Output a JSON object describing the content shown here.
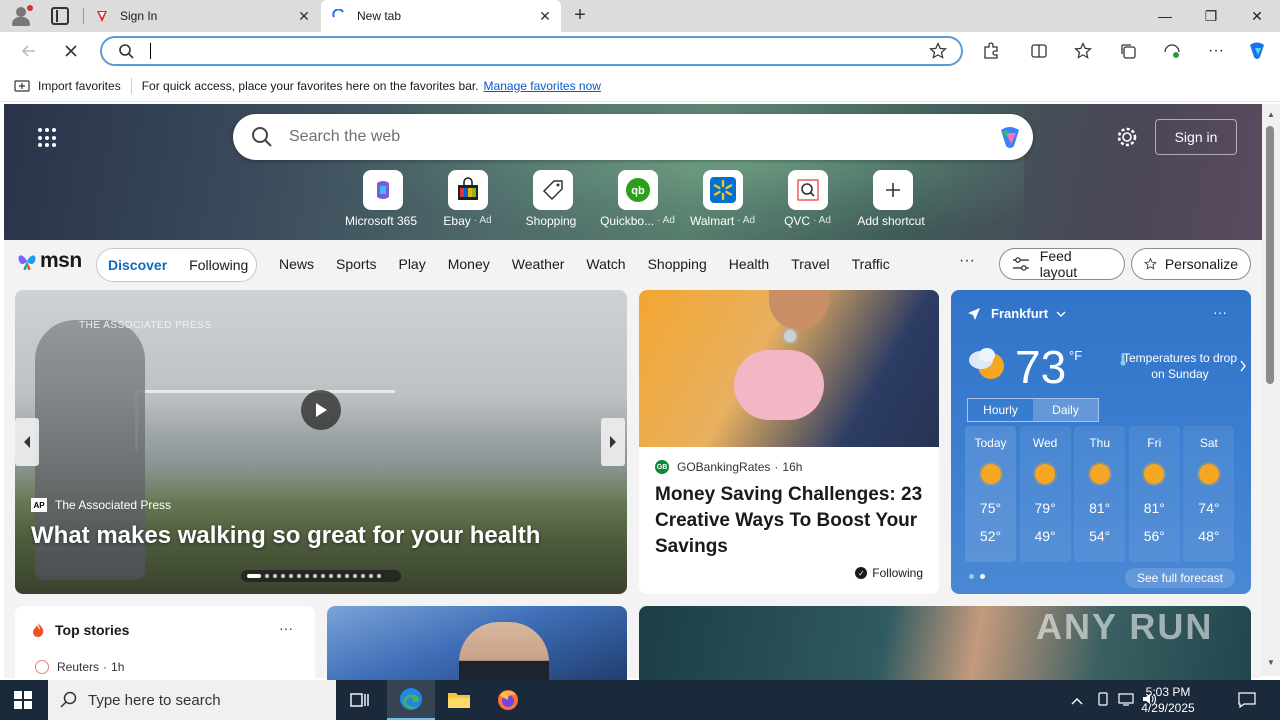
{
  "tabs": [
    {
      "title": "Sign In",
      "active": false
    },
    {
      "title": "New tab",
      "active": true
    }
  ],
  "addressbar": {
    "value": "",
    "placeholder": ""
  },
  "favorites_bar": {
    "import_label": "Import favorites",
    "message": "For quick access, place your favorites here on the favorites bar.",
    "link": "Manage favorites now"
  },
  "hero": {
    "search_placeholder": "Search the web",
    "sign_in": "Sign in",
    "shortcuts": [
      {
        "label": "Microsoft 365",
        "ad": "",
        "icon": "microsoft365-icon"
      },
      {
        "label": "Ebay",
        "ad": "· Ad",
        "icon": "ebay-icon"
      },
      {
        "label": "Shopping",
        "ad": "",
        "icon": "shopping-tag-icon"
      },
      {
        "label": "Quickbo...",
        "ad": "· Ad",
        "icon": "quickbooks-icon"
      },
      {
        "label": "Walmart",
        "ad": "· Ad",
        "icon": "walmart-icon"
      },
      {
        "label": "QVC",
        "ad": "· Ad",
        "icon": "qvc-icon"
      },
      {
        "label": "Add shortcut",
        "ad": "",
        "icon": "plus-icon"
      }
    ]
  },
  "msn": {
    "logo": "msn",
    "pills": [
      "Discover",
      "Following"
    ],
    "nav": [
      "News",
      "Sports",
      "Play",
      "Money",
      "Weather",
      "Watch",
      "Shopping",
      "Health",
      "Travel",
      "Traffic"
    ],
    "more": "···",
    "feed_layout": "Feed layout",
    "personalize": "Personalize"
  },
  "hero_story": {
    "watermark": "THE ASSOCIATED PRESS",
    "source": "The Associated Press",
    "source_logo": "AP",
    "title": "What makes walking so great for your health"
  },
  "money_story": {
    "source": "GOBankingRates",
    "time": "16h",
    "title": "Money Saving Challenges: 23 Creative Ways To Boost Your Savings",
    "following": "Following"
  },
  "weather": {
    "location": "Frankfurt",
    "more": "···",
    "temp": "73",
    "unit": "°F",
    "note": "Temperatures to drop on Sunday",
    "toggle": [
      "Hourly",
      "Daily"
    ],
    "days": [
      {
        "day": "Today",
        "hi": "75°",
        "lo": "52°"
      },
      {
        "day": "Wed",
        "hi": "79°",
        "lo": "49°"
      },
      {
        "day": "Thu",
        "hi": "81°",
        "lo": "54°"
      },
      {
        "day": "Fri",
        "hi": "81°",
        "lo": "56°"
      },
      {
        "day": "Sat",
        "hi": "74°",
        "lo": "48°"
      }
    ],
    "see_full": "See full forecast"
  },
  "top_stories": {
    "title": "Top stories",
    "more": "···",
    "first_source": "Reuters",
    "first_time": "1h"
  },
  "watermark": "ANY RUN",
  "taskbar": {
    "search_placeholder": "Type here to search",
    "time": "5:03 PM",
    "date": "4/29/2025"
  },
  "colors": {
    "accent": "#0f6cbd",
    "taskbar": "#1b2a3a",
    "weather": "#3174c8"
  }
}
